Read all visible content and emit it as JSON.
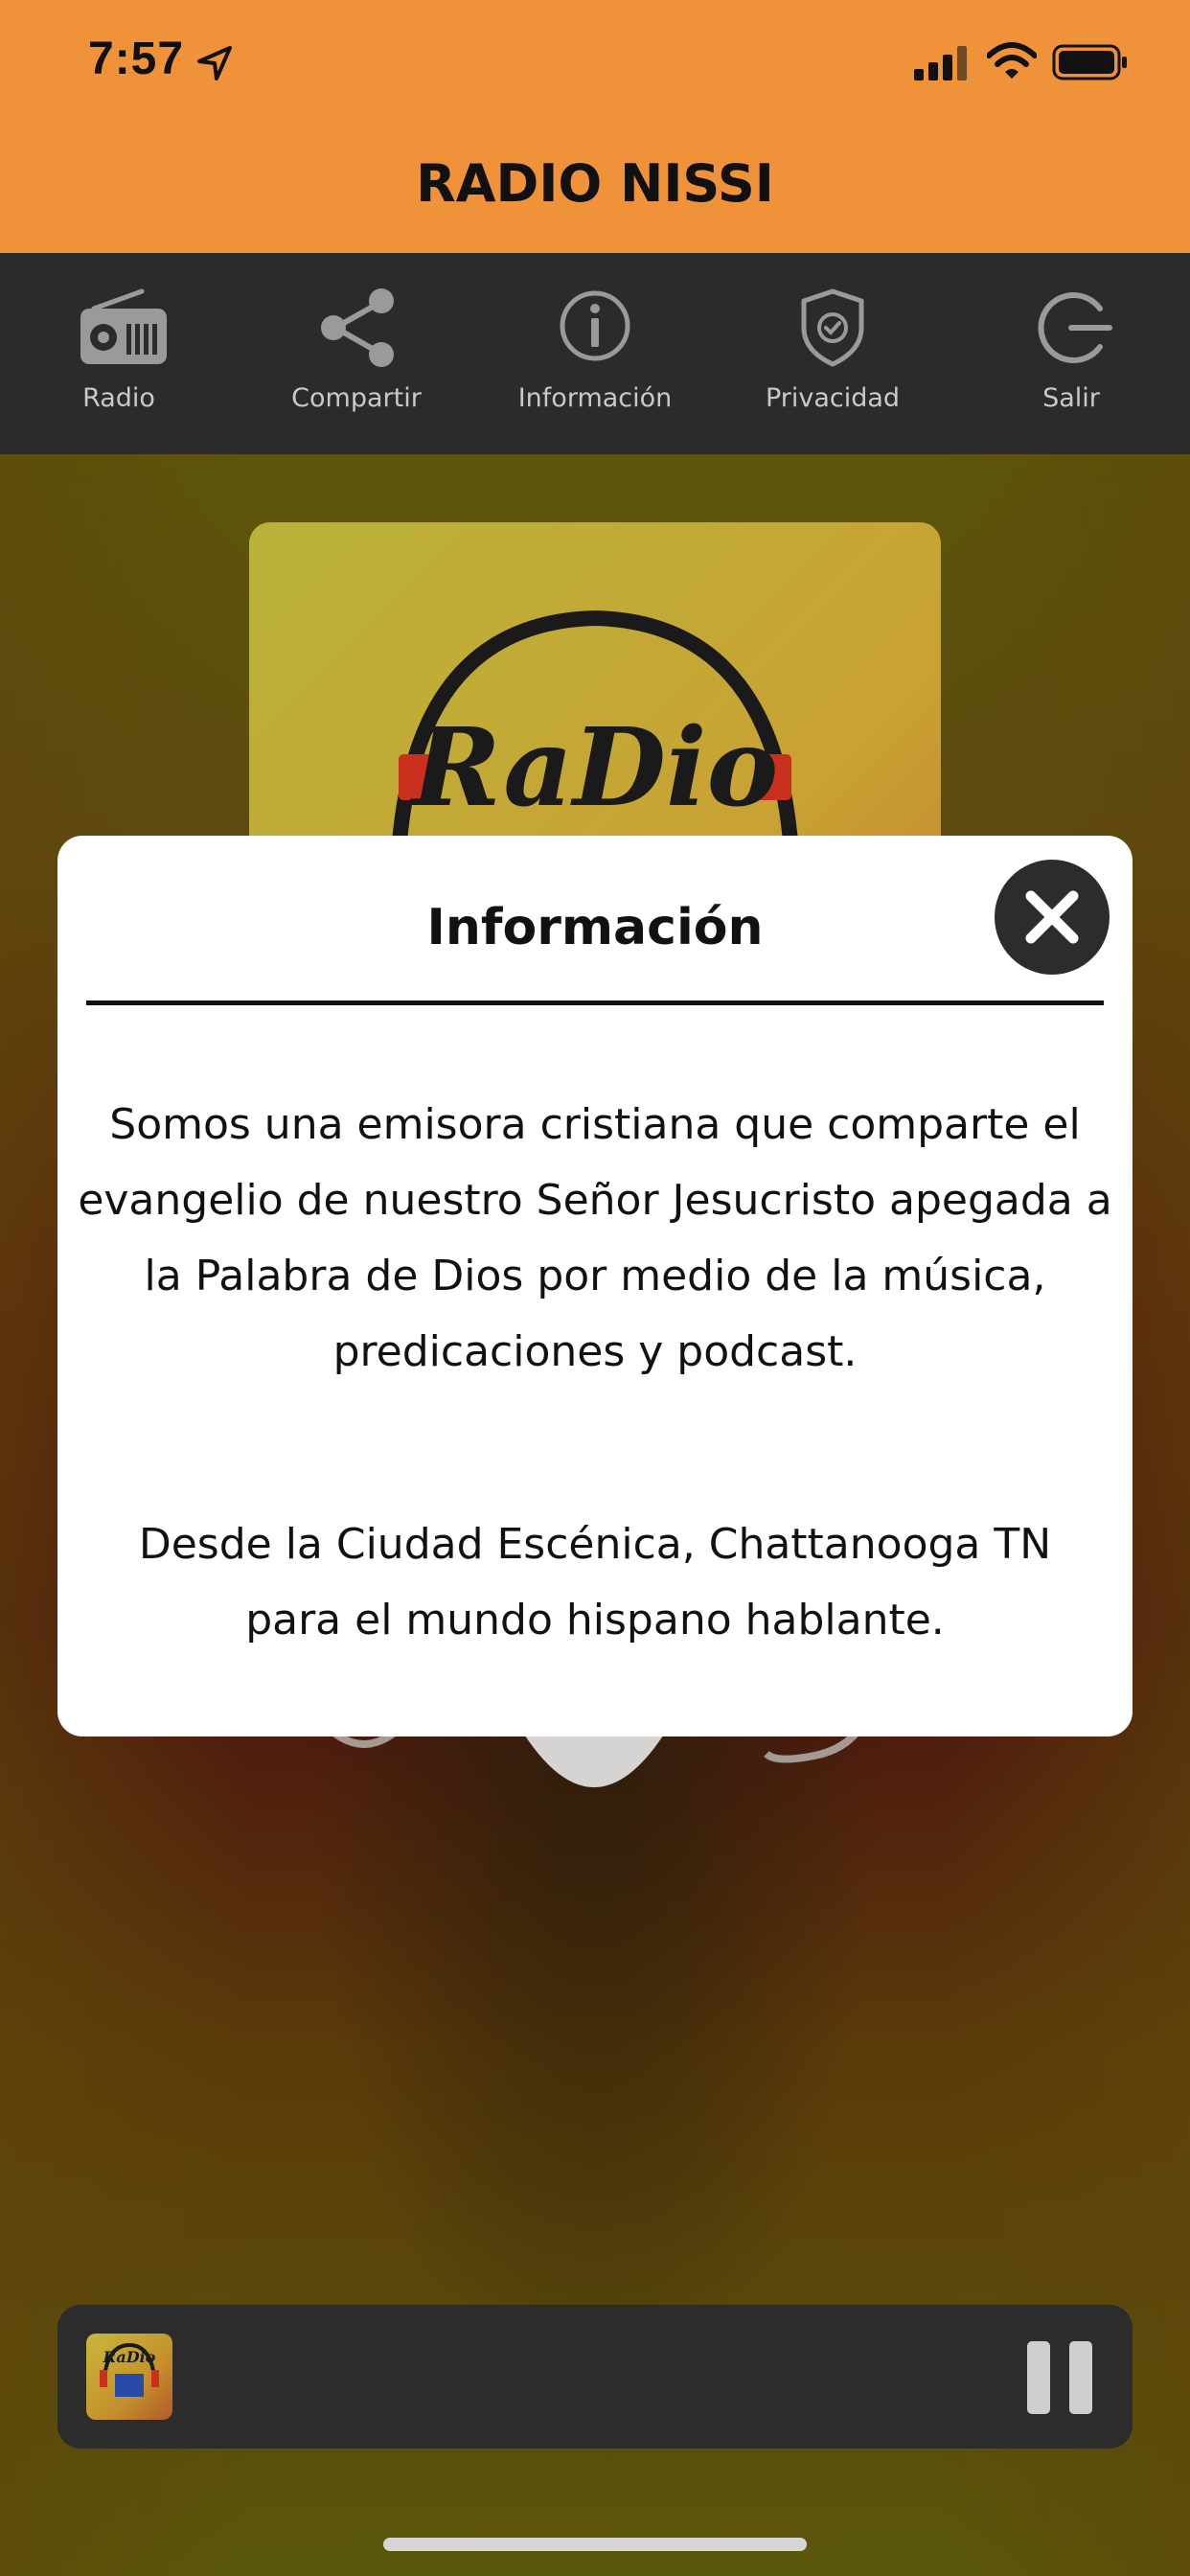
{
  "status_bar": {
    "time": "7:57"
  },
  "header": {
    "title": "RADIO NISSI"
  },
  "nav": {
    "items": [
      {
        "label": "Radio",
        "icon": "radio-icon"
      },
      {
        "label": "Compartir",
        "icon": "share-icon"
      },
      {
        "label": "Información",
        "icon": "info-icon"
      },
      {
        "label": "Privacidad",
        "icon": "shield-icon"
      },
      {
        "label": "Salir",
        "icon": "logout-icon"
      }
    ]
  },
  "album": {
    "logo_text": "RaDio"
  },
  "modal": {
    "title": "Información",
    "paragraph1": "Somos una emisora cristiana que comparte el evangelio de nuestro Señor Jesucristo apegada a la Palabra de Dios por medio de la música, predicaciones y podcast.",
    "paragraph2": "Desde la Ciudad Escénica, Chattanooga TN para el mundo hispano hablante."
  },
  "player": {
    "thumb_text": "RaDio"
  },
  "colors": {
    "header": "#f0923a",
    "nav_bg": "#2b2b2c",
    "nav_icon": "#9a9a9a",
    "modal_bg": "#ffffff",
    "close_button": "#2c2c2c",
    "player_bg": "#2c2c2c"
  }
}
